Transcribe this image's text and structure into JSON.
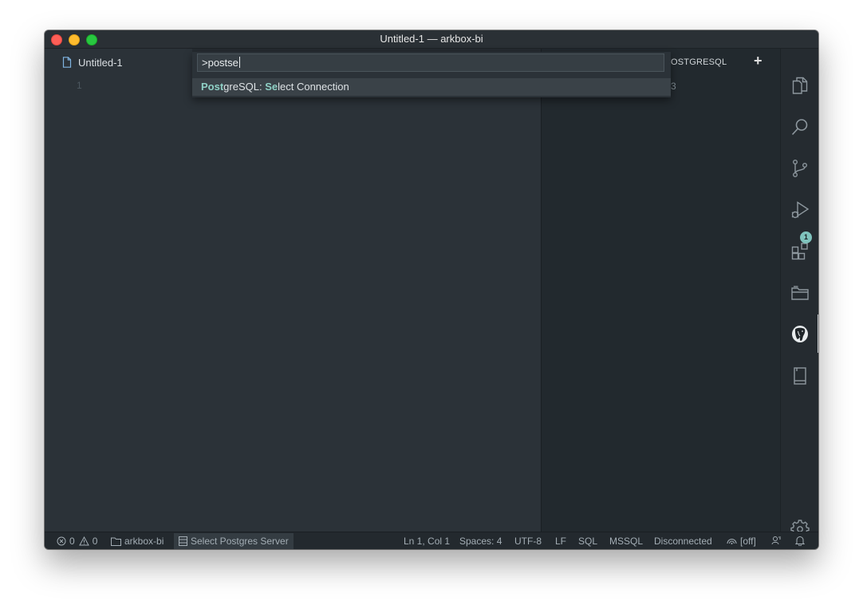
{
  "window": {
    "title": "Untitled-1 — arkbox-bi"
  },
  "tab": {
    "label": "Untitled-1"
  },
  "editor": {
    "line_number": "1"
  },
  "side_panel": {
    "title_partial": "OSTGRESQL",
    "add_label": "+",
    "hidden_text": "3"
  },
  "command_palette": {
    "input_value": ">postse",
    "result": {
      "match1": "Post",
      "part2": "greSQL: ",
      "match2": "Se",
      "part3": "lect Connection"
    }
  },
  "activity_bar": {
    "items": [
      "explorer-icon",
      "search-icon",
      "source-control-icon",
      "run-debug-icon",
      "extensions-icon",
      "folder-icon",
      "postgresql-icon",
      "bookmark-icon",
      "settings-icon"
    ],
    "extensions_badge": "1"
  },
  "status_bar": {
    "errors": "0",
    "warnings": "0",
    "folder": "arkbox-bi",
    "server": "Select Postgres Server",
    "position": "Ln 1, Col 1",
    "spaces": "Spaces: 4",
    "encoding": "UTF-8",
    "eol": "LF",
    "language": "SQL",
    "mssql": "MSSQL",
    "connection": "Disconnected",
    "live": "[off]"
  },
  "colors": {
    "highlight": "#8fd1c6",
    "badge": "#7fc3bd",
    "editor_bg": "#2b3238"
  }
}
